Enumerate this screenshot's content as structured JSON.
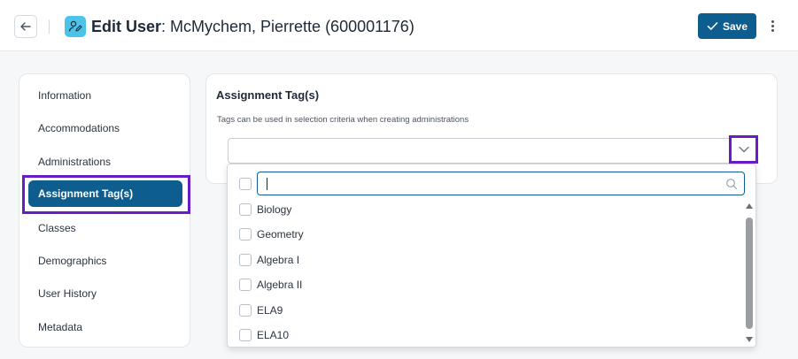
{
  "header": {
    "title_bold": "Edit User",
    "title_rest": ": McMychem, Pierrette (600001176)",
    "save_label": "Save"
  },
  "sidebar": {
    "items": [
      {
        "label": "Information"
      },
      {
        "label": "Accommodations"
      },
      {
        "label": "Administrations"
      },
      {
        "label": "Assignment Tag(s)",
        "active": true
      },
      {
        "label": "Classes"
      },
      {
        "label": "Demographics"
      },
      {
        "label": "User History"
      },
      {
        "label": "Metadata"
      }
    ]
  },
  "panel": {
    "title": "Assignment Tag(s)",
    "description": "Tags can be used in selection criteria when creating administrations"
  },
  "dropdown": {
    "search_value": "",
    "options": [
      {
        "label": "Biology",
        "checked": false
      },
      {
        "label": "Geometry",
        "checked": false
      },
      {
        "label": "Algebra I",
        "checked": false
      },
      {
        "label": "Algebra II",
        "checked": false
      },
      {
        "label": "ELA9",
        "checked": false
      },
      {
        "label": "ELA10",
        "checked": false
      }
    ]
  },
  "colors": {
    "primary": "#0d5d8f",
    "highlight": "#6a1cc4",
    "icon_accent": "#4cc3e8"
  }
}
